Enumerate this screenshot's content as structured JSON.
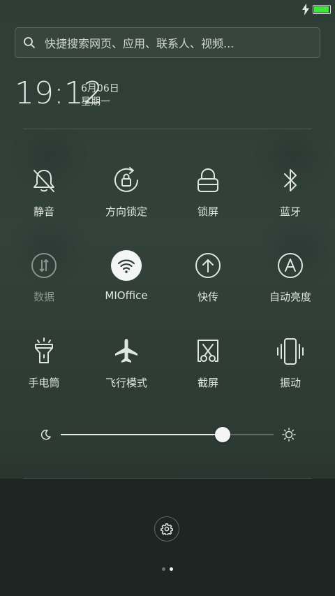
{
  "search": {
    "placeholder": "快捷搜索网页、应用、联系人、视频..."
  },
  "clock": {
    "time": "19:12",
    "date": "6月06日",
    "weekday": "星期一"
  },
  "toggles": [
    {
      "label": "静音",
      "icon": "bell-off-icon",
      "active": false,
      "dim": false
    },
    {
      "label": "方向锁定",
      "icon": "rotation-lock-icon",
      "active": false,
      "dim": false
    },
    {
      "label": "锁屏",
      "icon": "lock-icon",
      "active": false,
      "dim": false
    },
    {
      "label": "蓝牙",
      "icon": "bluetooth-icon",
      "active": false,
      "dim": false
    },
    {
      "label": "数据",
      "icon": "mobile-data-icon",
      "active": false,
      "dim": true
    },
    {
      "label": "MIOffice",
      "icon": "wifi-icon",
      "active": true,
      "dim": false
    },
    {
      "label": "快传",
      "icon": "upload-arrow-icon",
      "active": false,
      "dim": false
    },
    {
      "label": "自动亮度",
      "icon": "auto-brightness-icon",
      "active": false,
      "dim": false
    },
    {
      "label": "手电筒",
      "icon": "flashlight-icon",
      "active": false,
      "dim": false
    },
    {
      "label": "飞行模式",
      "icon": "airplane-icon",
      "active": false,
      "dim": false
    },
    {
      "label": "截屏",
      "icon": "screenshot-scissors-icon",
      "active": false,
      "dim": false
    },
    {
      "label": "振动",
      "icon": "vibrate-icon",
      "active": false,
      "dim": false
    }
  ],
  "brightness": {
    "level": 0.76
  },
  "pager": {
    "count": 2,
    "active": 1
  },
  "colors": {
    "battery": "#3ee43a",
    "accent": "#f4f6f5",
    "icon": "#dfe6e2",
    "dim": "#8a948f"
  }
}
